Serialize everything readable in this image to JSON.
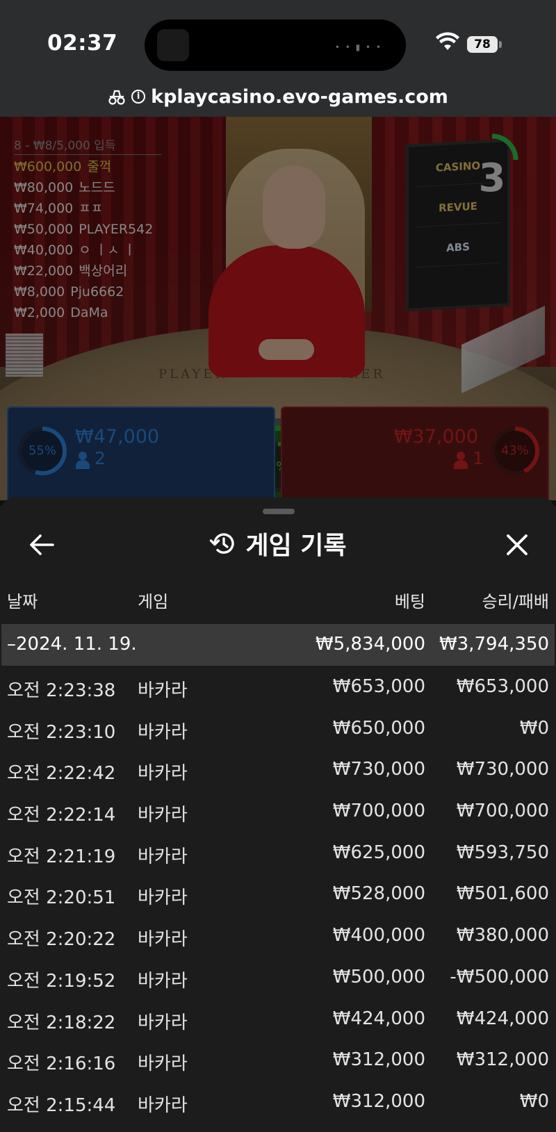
{
  "status_bar": {
    "time": "02:37",
    "battery": "78"
  },
  "browser": {
    "url": "kplaycasino.evo-games.com"
  },
  "stream": {
    "leaderboard_header": "8 - ₩8/5,000 입득",
    "leaderboard": [
      {
        "amount": "₩600,000",
        "name": "줄꺽"
      },
      {
        "amount": "₩80,000",
        "name": "노드드"
      },
      {
        "amount": "₩74,000",
        "name": "ㅍㅍ"
      },
      {
        "amount": "₩50,000",
        "name": "PLAYER542"
      },
      {
        "amount": "₩40,000",
        "name": "ㅇ ㅣㅅ ㅣ"
      },
      {
        "amount": "₩22,000",
        "name": "백상어리"
      },
      {
        "amount": "₩8,000",
        "name": "Pju6662"
      },
      {
        "amount": "₩2,000",
        "name": "DaMa"
      }
    ],
    "countdown": "3",
    "monitor_logos": [
      "CASINO",
      "REVUE",
      "ABS"
    ],
    "table_labels": {
      "player": "PLAYER",
      "banker": "BANKER"
    }
  },
  "bets": {
    "player": {
      "percent": "55%",
      "percent_value": 55,
      "amount": "₩47,000",
      "count": "2"
    },
    "tie": {
      "percent": "2%",
      "percent_value": 2
    },
    "banker": {
      "percent": "43%",
      "percent_value": 43,
      "amount": "₩37,000",
      "count": "1"
    }
  },
  "history": {
    "title": "게임 기록",
    "columns": {
      "date": "날짜",
      "game": "게임",
      "bet": "베팅",
      "result": "승리/패배"
    },
    "date_group": {
      "date": "–2024. 11. 19.",
      "bet_total": "₩5,834,000",
      "result_total": "₩3,794,350"
    },
    "rows": [
      {
        "time": "오전 2:23:38",
        "game": "바카라",
        "bet": "₩653,000",
        "result": "₩653,000"
      },
      {
        "time": "오전 2:23:10",
        "game": "바카라",
        "bet": "₩650,000",
        "result": "₩0"
      },
      {
        "time": "오전 2:22:42",
        "game": "바카라",
        "bet": "₩730,000",
        "result": "₩730,000"
      },
      {
        "time": "오전 2:22:14",
        "game": "바카라",
        "bet": "₩700,000",
        "result": "₩700,000"
      },
      {
        "time": "오전 2:21:19",
        "game": "바카라",
        "bet": "₩625,000",
        "result": "₩593,750"
      },
      {
        "time": "오전 2:20:51",
        "game": "바카라",
        "bet": "₩528,000",
        "result": "₩501,600"
      },
      {
        "time": "오전 2:20:22",
        "game": "바카라",
        "bet": "₩400,000",
        "result": "₩380,000"
      },
      {
        "time": "오전 2:19:52",
        "game": "바카라",
        "bet": "₩500,000",
        "result": "-₩500,000"
      },
      {
        "time": "오전 2:18:22",
        "game": "바카라",
        "bet": "₩424,000",
        "result": "₩424,000"
      },
      {
        "time": "오전 2:16:16",
        "game": "바카라",
        "bet": "₩312,000",
        "result": "₩312,000"
      },
      {
        "time": "오전 2:15:44",
        "game": "바카라",
        "bet": "₩312,000",
        "result": "₩0"
      }
    ]
  },
  "colors": {
    "player_blue": "#2d7fd6",
    "banker_red": "#c42424",
    "tie_green": "#2fa52f",
    "gold": "#d9c250"
  }
}
